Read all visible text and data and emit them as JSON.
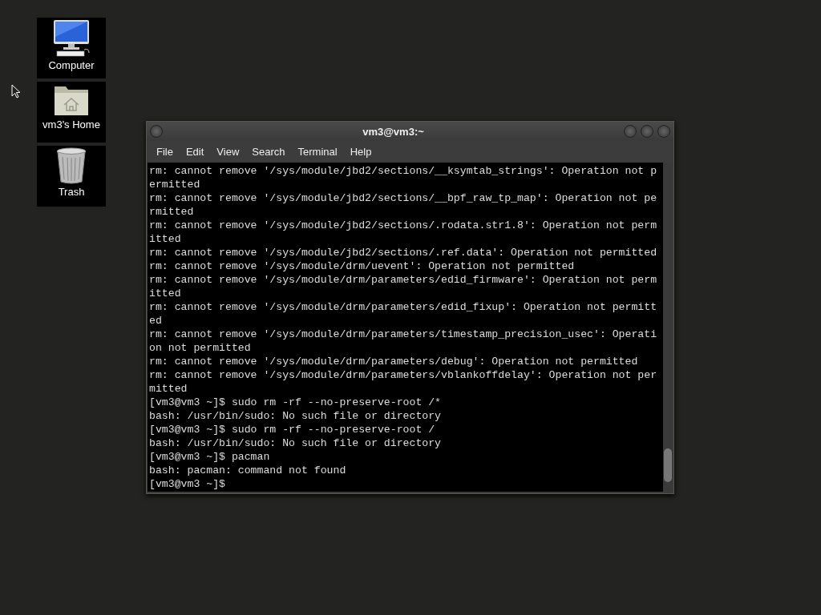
{
  "desktop_icons": [
    {
      "kind": "computer",
      "label": "Computer"
    },
    {
      "kind": "home",
      "label": "vm3's Home"
    },
    {
      "kind": "trash",
      "label": "Trash"
    }
  ],
  "window": {
    "title": "vm3@vm3:~"
  },
  "menu": [
    "File",
    "Edit",
    "View",
    "Search",
    "Terminal",
    "Help"
  ],
  "terminal_lines": [
    "rm: cannot remove '/sys/module/jbd2/sections/__ksymtab_strings': Operation not p",
    "ermitted",
    "rm: cannot remove '/sys/module/jbd2/sections/__bpf_raw_tp_map': Operation not pe",
    "rmitted",
    "rm: cannot remove '/sys/module/jbd2/sections/.rodata.str1.8': Operation not perm",
    "itted",
    "rm: cannot remove '/sys/module/jbd2/sections/.ref.data': Operation not permitted",
    "rm: cannot remove '/sys/module/drm/uevent': Operation not permitted",
    "rm: cannot remove '/sys/module/drm/parameters/edid_firmware': Operation not perm",
    "itted",
    "rm: cannot remove '/sys/module/drm/parameters/edid_fixup': Operation not permitt",
    "ed",
    "rm: cannot remove '/sys/module/drm/parameters/timestamp_precision_usec': Operati",
    "on not permitted",
    "rm: cannot remove '/sys/module/drm/parameters/debug': Operation not permitted",
    "rm: cannot remove '/sys/module/drm/parameters/vblankoffdelay': Operation not per",
    "mitted",
    "[vm3@vm3 ~]$ sudo rm -rf --no-preserve-root /*",
    "bash: /usr/bin/sudo: No such file or directory",
    "[vm3@vm3 ~]$ sudo rm -rf --no-preserve-root /",
    "bash: /usr/bin/sudo: No such file or directory",
    "[vm3@vm3 ~]$ pacman",
    "bash: pacman: command not found",
    "[vm3@vm3 ~]$"
  ]
}
